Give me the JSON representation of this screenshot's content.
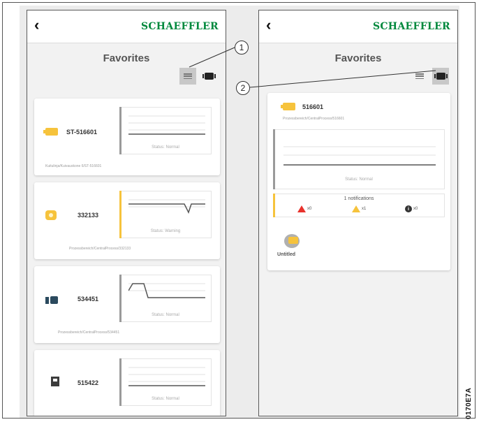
{
  "brand": "SCHAEFFLER",
  "back_glyph": "‹",
  "brand_color": "#00893d",
  "accent_yellow": "#f6c33c",
  "screen_left": {
    "title": "Favorites",
    "cards": [
      {
        "name": "ST-516601",
        "path": "Kuitulinja/Kuivauskone 6/ST-516601",
        "status": "Status: Normal",
        "icon": "bearing-sensor-icon"
      },
      {
        "name": "332133",
        "path": "Prozessbereich/CentralProcess/332133",
        "status": "Status: Warning",
        "icon": "round-sensor-icon"
      },
      {
        "name": "534451",
        "path": "Prozessbereich/CentralProcess/534451",
        "status": "Status: Normal",
        "icon": "gateway-icon"
      },
      {
        "name": "515422",
        "path": "",
        "status": "Status: Normal",
        "icon": "sensor-box-icon"
      }
    ]
  },
  "screen_right": {
    "title": "Favorites",
    "detail": {
      "name": "516601",
      "path": "Prozessbereich/CentralProcess/516601",
      "status": "Status: Normal",
      "notifications_label": "1 notifications",
      "alarm_count": "x0",
      "warning_count": "x1",
      "info_count": "x0"
    },
    "group_label": "Untitled"
  },
  "callouts": [
    "1",
    "2"
  ],
  "figure_code": "0170E7A"
}
